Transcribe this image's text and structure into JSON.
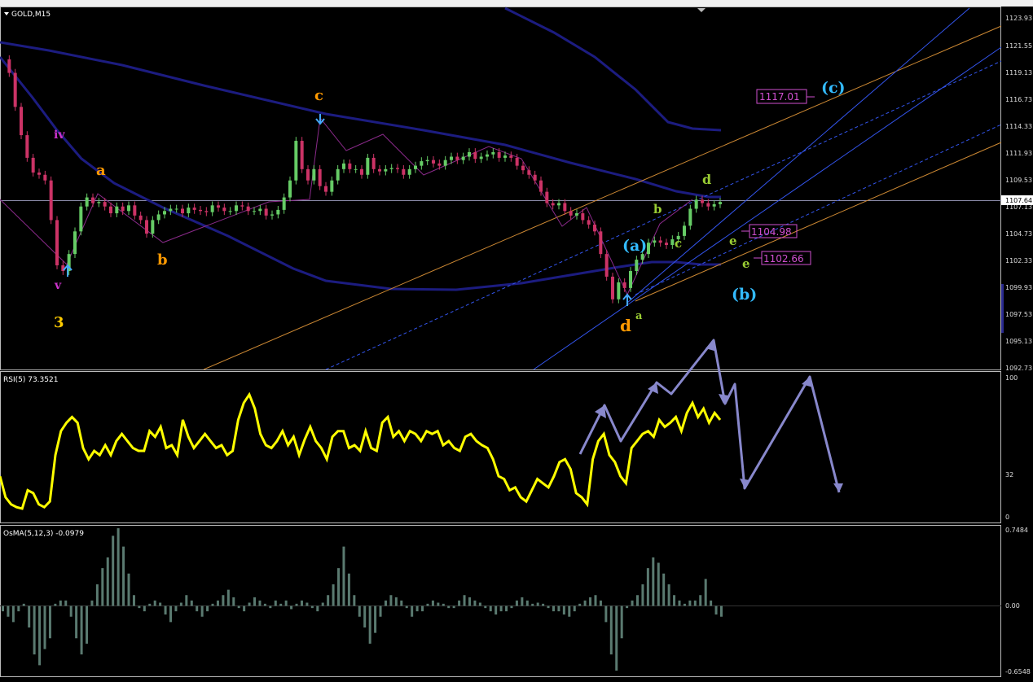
{
  "window": {
    "symbol_label": "GOLD,M15"
  },
  "price_axis": {
    "ticks": [
      "1123.93",
      "1121.55",
      "1119.13",
      "1116.73",
      "1114.33",
      "1111.93",
      "1109.53",
      "1107.13",
      "1104.73",
      "1102.33",
      "1099.93",
      "1097.53",
      "1095.13",
      "1092.73"
    ],
    "current_price": "1107.64"
  },
  "rsi_axis": {
    "ticks": [
      "100",
      "32",
      "0"
    ]
  },
  "osma_axis": {
    "ticks": [
      "0.7484",
      "0.00",
      "-0.6548"
    ]
  },
  "indicators": {
    "rsi_label": "RSI(5) 73.3521",
    "osma_label": "OsMA(5,12,3) -0.0979"
  },
  "price_labels": [
    {
      "text": "1117.01"
    },
    {
      "text": "1104.98"
    },
    {
      "text": "1102.66"
    }
  ],
  "wave_labels": [
    {
      "text": "iv",
      "color": "#cc33cc"
    },
    {
      "text": "v",
      "color": "#cc33cc"
    },
    {
      "text": "3",
      "color": "#ffcc00"
    },
    {
      "text": "a",
      "color": "#ff9900"
    },
    {
      "text": "b",
      "color": "#ff9900"
    },
    {
      "text": "c",
      "color": "#ff9900"
    },
    {
      "text": "d",
      "color": "#ff9900"
    },
    {
      "text": "(a)",
      "color": "#33bbff"
    },
    {
      "text": "(b)",
      "color": "#33bbff"
    },
    {
      "text": "(c)",
      "color": "#33bbff"
    },
    {
      "text": "a",
      "color": "#99cc33"
    },
    {
      "text": "b",
      "color": "#99cc33"
    },
    {
      "text": "c",
      "color": "#99cc33"
    },
    {
      "text": "d",
      "color": "#99cc33"
    },
    {
      "text": "e",
      "color": "#99cc33"
    },
    {
      "text": "e",
      "color": "#99cc33"
    }
  ],
  "colors": {
    "background": "#000000",
    "bull_candle": "#66cc66",
    "bear_candle": "#cc3366",
    "moving_average": "#1c1c80",
    "rsi_line": "#ffff00",
    "forecast_arrows": "#8888cc",
    "channel_blue": "#3355ee",
    "channel_orange": "#cc8833",
    "osma_bars": "#5a7a70"
  },
  "chart_data": [
    {
      "type": "candlestick",
      "title": "GOLD,M15",
      "ylim": [
        1092.73,
        1123.93
      ],
      "close_path": [
        1120.2,
        1119,
        1116,
        1113.5,
        1111.5,
        1110.2,
        1110,
        1109.5,
        1106,
        1102,
        1101.5,
        1103,
        1105,
        1107.2,
        1108,
        1107.5,
        1107.6,
        1107.2,
        1106.6,
        1107.2,
        1106.8,
        1107.3,
        1106.4,
        1106,
        1104.8,
        1106,
        1106.5,
        1106.8,
        1107,
        1107,
        1106.6,
        1107.1,
        1106.9,
        1106.8,
        1106.7,
        1107.3,
        1107.1,
        1106.8,
        1106.8,
        1107.3,
        1107.2,
        1106.8,
        1106.8,
        1107,
        1106.4,
        1106.5,
        1106.9,
        1108,
        1109.5,
        1113,
        1110.5,
        1109.5,
        1110.5,
        1109,
        1108.5,
        1109.5,
        1110.5,
        1111,
        1110.5,
        1110.5,
        1110,
        1111.5,
        1110.5,
        1110.3,
        1110.5,
        1110.6,
        1110.5,
        1110,
        1110.5,
        1110.8,
        1111.2,
        1111.3,
        1111,
        1110.8,
        1111.3,
        1111.6,
        1111.3,
        1111.6,
        1112,
        1111.4,
        1111.6,
        1111.8,
        1112,
        1111.5,
        1111.7,
        1111.5,
        1110.8,
        1110.4,
        1110,
        1109.5,
        1108.5,
        1107.5,
        1107.3,
        1107.5,
        1106.8,
        1106.4,
        1106.6,
        1106,
        1105.6,
        1105,
        1103,
        1101,
        1099,
        1100.5,
        1100,
        1101.5,
        1102.5,
        1103,
        1104,
        1104.2,
        1104,
        1103.8,
        1104.3,
        1104.6,
        1105.5,
        1107,
        1107.8,
        1107.5,
        1107.2,
        1107.4,
        1107.6
      ]
    },
    {
      "type": "line",
      "title": "RSI(5) 73.3521",
      "ylim": [
        0,
        100
      ],
      "values": [
        30,
        15,
        10,
        8,
        7,
        20,
        18,
        10,
        8,
        12,
        45,
        62,
        68,
        72,
        68,
        50,
        42,
        48,
        45,
        52,
        45,
        55,
        60,
        55,
        50,
        48,
        48,
        62,
        58,
        65,
        50,
        52,
        45,
        70,
        58,
        50,
        55,
        60,
        55,
        50,
        52,
        45,
        48,
        70,
        82,
        88,
        78,
        60,
        52,
        50,
        55,
        62,
        52,
        58,
        45,
        56,
        65,
        55,
        50,
        42,
        58,
        62,
        62,
        50,
        52,
        48,
        62,
        50,
        48,
        68,
        72,
        58,
        62,
        55,
        62,
        60,
        55,
        62,
        60,
        62,
        52,
        55,
        50,
        48,
        58,
        60,
        55,
        52,
        50,
        42,
        30,
        28,
        20,
        22,
        15,
        12,
        20,
        28,
        25,
        22,
        30,
        40,
        42,
        35,
        18,
        15,
        10,
        42,
        55,
        60,
        45,
        40,
        30,
        25,
        50,
        55,
        60,
        62,
        58,
        70,
        65,
        68,
        72,
        62,
        75,
        82,
        72,
        78,
        68,
        75,
        70
      ]
    },
    {
      "type": "bar",
      "title": "OsMA(5,12,3) -0.0979",
      "ylim": [
        -0.6548,
        0.7484
      ],
      "values": [
        -0.05,
        -0.1,
        -0.15,
        -0.05,
        0.02,
        -0.2,
        -0.45,
        -0.55,
        -0.4,
        -0.3,
        0.02,
        0.05,
        0.05,
        -0.1,
        -0.3,
        -0.45,
        -0.35,
        0.05,
        0.2,
        0.35,
        0.45,
        0.65,
        0.72,
        0.55,
        0.3,
        0.1,
        -0.02,
        -0.05,
        0.02,
        0.05,
        0.03,
        -0.08,
        -0.15,
        -0.05,
        0.03,
        0.1,
        0.05,
        -0.05,
        -0.1,
        -0.05,
        0.02,
        0.05,
        0.1,
        0.15,
        0.08,
        -0.02,
        -0.05,
        0.03,
        0.08,
        0.05,
        0.02,
        -0.02,
        0.05,
        0.02,
        0.05,
        -0.03,
        0.02,
        0.05,
        0.03,
        -0.02,
        -0.05,
        0.03,
        0.1,
        0.2,
        0.35,
        0.55,
        0.3,
        0.1,
        -0.1,
        -0.2,
        -0.35,
        -0.25,
        -0.1,
        0.05,
        0.1,
        0.08,
        0.05,
        -0.02,
        -0.1,
        -0.05,
        -0.05,
        0.02,
        0.05,
        0.03,
        0.02,
        -0.02,
        -0.02,
        0.05,
        0.1,
        0.08,
        0.05,
        0.03,
        -0.02,
        -0.05,
        -0.08,
        -0.05,
        -0.05,
        -0.02,
        0.05,
        0.08,
        0.05,
        0.02,
        0.03,
        0.02,
        -0.02,
        -0.05,
        -0.05,
        -0.08,
        -0.1,
        -0.05,
        0.02,
        0.05,
        0.08,
        0.1,
        0.05,
        -0.15,
        -0.45,
        -0.6,
        -0.3,
        -0.02,
        0.05,
        0.1,
        0.2,
        0.35,
        0.45,
        0.4,
        0.3,
        0.2,
        0.1,
        0.05,
        0.02,
        0.05,
        0.05,
        0.1,
        0.25,
        0.05,
        -0.08,
        -0.1
      ]
    }
  ]
}
